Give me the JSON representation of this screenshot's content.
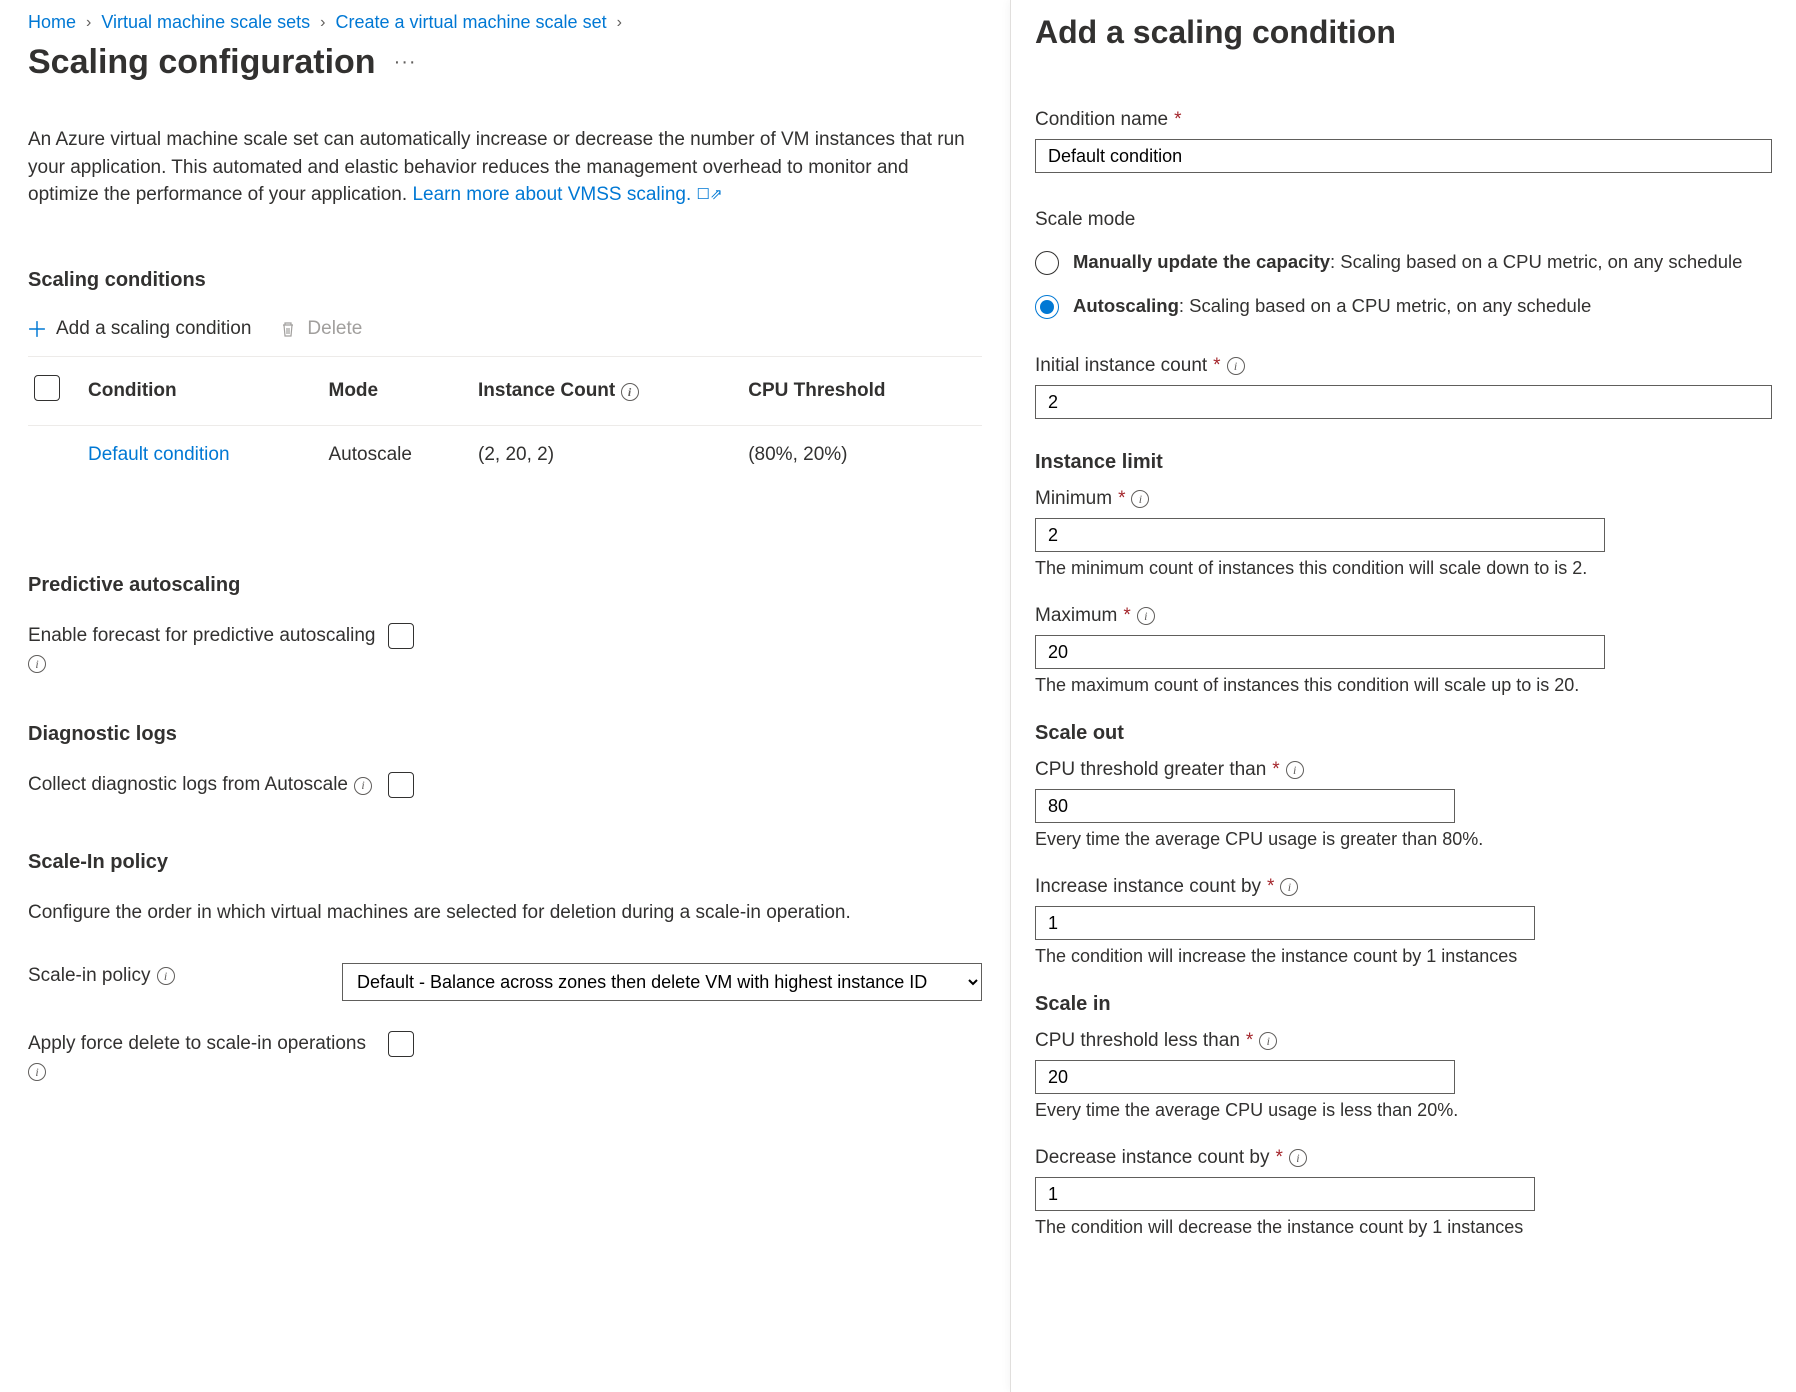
{
  "breadcrumb": {
    "items": [
      "Home",
      "Virtual machine scale sets",
      "Create a virtual machine scale set"
    ]
  },
  "page": {
    "title": "Scaling configuration"
  },
  "intro": {
    "text": "An Azure virtual machine scale set can automatically increase or decrease the number of VM instances that run your application. This automated and elastic behavior reduces the management overhead to monitor and optimize the performance of your application. ",
    "link": "Learn more about VMSS scaling."
  },
  "sections": {
    "scaling_conditions": "Scaling conditions",
    "predictive": "Predictive autoscaling",
    "diagnostic": "Diagnostic logs",
    "scale_in": "Scale-In policy"
  },
  "toolbar": {
    "add": "Add a scaling condition",
    "delete": "Delete"
  },
  "table": {
    "headers": {
      "condition": "Condition",
      "mode": "Mode",
      "instance_count": "Instance Count",
      "cpu_threshold": "CPU Threshold"
    },
    "rows": [
      {
        "condition": "Default condition",
        "mode": "Autoscale",
        "instance_count": "(2, 20, 2)",
        "cpu_threshold": "(80%, 20%)"
      }
    ]
  },
  "predictive": {
    "label": "Enable forecast for predictive autoscaling"
  },
  "diagnostic": {
    "label": "Collect diagnostic logs from Autoscale"
  },
  "scale_in_policy": {
    "desc": "Configure the order in which virtual machines are selected for deletion during a scale-in operation.",
    "policy_label": "Scale-in policy",
    "policy_value": "Default - Balance across zones then delete VM with highest instance ID",
    "force_delete_label": "Apply force delete to scale-in operations"
  },
  "blade": {
    "title": "Add a scaling condition",
    "condition_name_label": "Condition name",
    "condition_name_value": "Default condition",
    "scale_mode_label": "Scale mode",
    "radio_manual_bold": "Manually update the capacity",
    "radio_manual_rest": ": Scaling based on a CPU metric, on any schedule",
    "radio_auto_bold": "Autoscaling",
    "radio_auto_rest": ": Scaling based on a CPU metric, on any schedule",
    "initial_count_label": "Initial instance count",
    "initial_count_value": "2",
    "instance_limit_title": "Instance limit",
    "min_label": "Minimum",
    "min_value": "2",
    "min_hint": "The minimum count of instances this condition will scale down to is 2.",
    "max_label": "Maximum",
    "max_value": "20",
    "max_hint": "The maximum count of instances this condition will scale up to is 20.",
    "scale_out_title": "Scale out",
    "cpu_gt_label": "CPU threshold greater than",
    "cpu_gt_value": "80",
    "cpu_gt_hint": "Every time the average CPU usage is greater than 80%.",
    "inc_label": "Increase instance count by",
    "inc_value": "1",
    "inc_hint": "The condition will increase the instance count by 1 instances",
    "scale_in_title": "Scale in",
    "cpu_lt_label": "CPU threshold less than",
    "cpu_lt_value": "20",
    "cpu_lt_hint": "Every time the average CPU usage is less than 20%.",
    "dec_label": "Decrease instance count by",
    "dec_value": "1",
    "dec_hint": "The condition will decrease the instance count by 1 instances"
  }
}
